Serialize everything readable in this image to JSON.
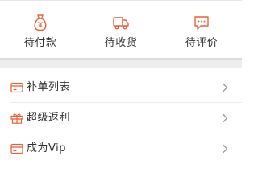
{
  "theme": {
    "accent": "#e8643c",
    "text": "#333333",
    "chevron": "#9a9a9a",
    "section_gap": "#eeeeee"
  },
  "orders": [
    {
      "label": "待付款",
      "icon": "money-bag-icon"
    },
    {
      "label": "待收货",
      "icon": "truck-icon"
    },
    {
      "label": "待评价",
      "icon": "comment-icon"
    }
  ],
  "menu": [
    {
      "label": "补单列表",
      "icon": "card-icon"
    },
    {
      "label": "超级返利",
      "icon": "gift-icon"
    },
    {
      "label": "成为Vip",
      "icon": "card-icon"
    }
  ]
}
